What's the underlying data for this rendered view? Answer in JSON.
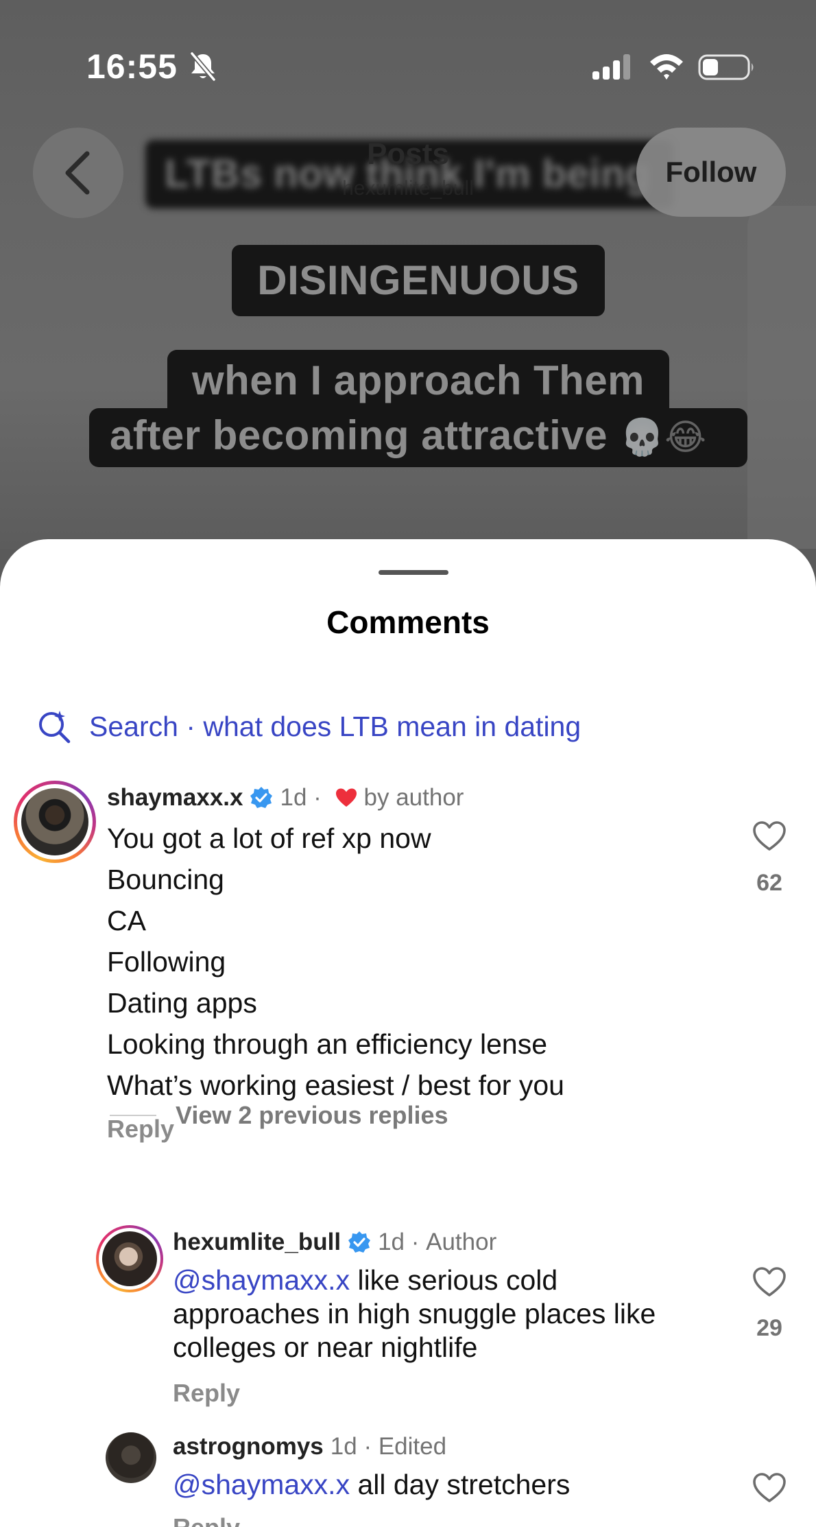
{
  "status_bar": {
    "time": "16:55",
    "bell": "bell-slash-icon",
    "signal": "signal-bars-icon",
    "wifi": "wifi-icon",
    "battery": "battery-low-icon"
  },
  "header": {
    "back_icon": "chevron-left-icon",
    "title": "Posts",
    "subtitle": "hexumlite_bull",
    "follow_label": "Follow"
  },
  "post": {
    "caption_lines": [
      "LTBs now think I'm being",
      "DISINGENUOUS",
      "when I approach Them",
      "after becoming attractive"
    ],
    "caption_emoji": "💀😂"
  },
  "comments_sheet": {
    "title": "Comments",
    "search_prefix": "Search",
    "search_separator": " · ",
    "search_query": "what does LTB mean in dating",
    "comments": [
      {
        "username": "shaymaxx.x",
        "verified": true,
        "time": "1d",
        "separator": " · ",
        "badge": "by author",
        "lines": [
          "You got a lot of ref xp now",
          "Bouncing",
          "CA",
          "Following",
          "Dating apps",
          "Looking through an efficiency lense",
          "What’s working easiest / best for you"
        ],
        "reply_label": "Reply",
        "likes": "62",
        "view_replies": "View 2 previous replies"
      },
      {
        "username": "hexumlite_bull",
        "verified": true,
        "time": "1d",
        "separator": " · ",
        "badge": "Author",
        "mention": "@shaymaxx.x",
        "text_line1": " like serious cold",
        "text_line2": "approaches in high snuggle places like",
        "text_line3": "colleges or near nightlife",
        "reply_label": "Reply",
        "likes": "29"
      },
      {
        "username": "astrognomys",
        "verified": false,
        "time": "1d",
        "separator": " · ",
        "badge": "Edited",
        "mention": "@shaymaxx.x",
        "text": " all day stretchers",
        "reply_label": "Reply"
      }
    ]
  },
  "colors": {
    "link": "#3845c4",
    "verified": "#3897f0",
    "heart": "#ed2f3c",
    "muted": "#737373"
  }
}
